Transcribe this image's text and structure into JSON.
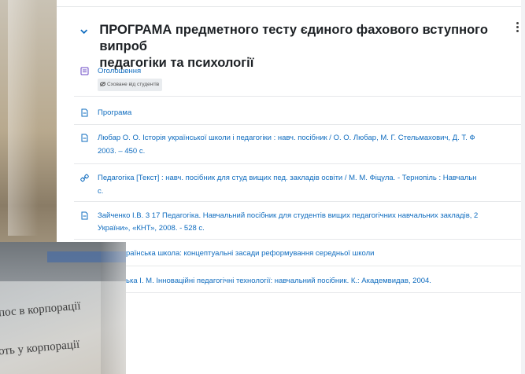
{
  "section": {
    "title": "ПРОГРАМА предметного тесту єдиного фахового вступного випроб\nпедагогіки та психології"
  },
  "items": [
    {
      "type": "forum",
      "text": "Оголошення",
      "badge": "Сховане від студентів"
    },
    {
      "type": "file",
      "text": "Програма"
    },
    {
      "type": "file",
      "text": "Любар О. О. Історія української школи і педагогіки : навч. посібник / О. О. Любар, М. Г. Стельмахович, Д. Т. Ф",
      "text2": "2003. – 450 с."
    },
    {
      "type": "url",
      "text": "Педагогіка [Текст] : навч. посібник для студ вищих пед. закладів освіти / М. М. Фіцула. - Тернопіль : Навчальн",
      "text2": "с."
    },
    {
      "type": "file",
      "text": "Зайченко І.В. 3 17 Педагогіка. Навчальний посібник для студентів вищих педагогічних навчальних закладів, 2",
      "text2": "України», «КНТ», 2008. - 528 с."
    },
    {
      "type": "file",
      "text": "раїнська школа: концептуальні засади реформування середньої школи"
    },
    {
      "type": "file",
      "text": "ька І. М. Інноваційні педагогічні технології: навчальний посібник. К.: Академвидав, 2004."
    }
  ],
  "overlay_photo": {
    "line1": "пос в корпорації",
    "line2": "оть у корпорації"
  },
  "colors": {
    "link": "#0f6cbf",
    "icon": "#0f6cbf"
  }
}
